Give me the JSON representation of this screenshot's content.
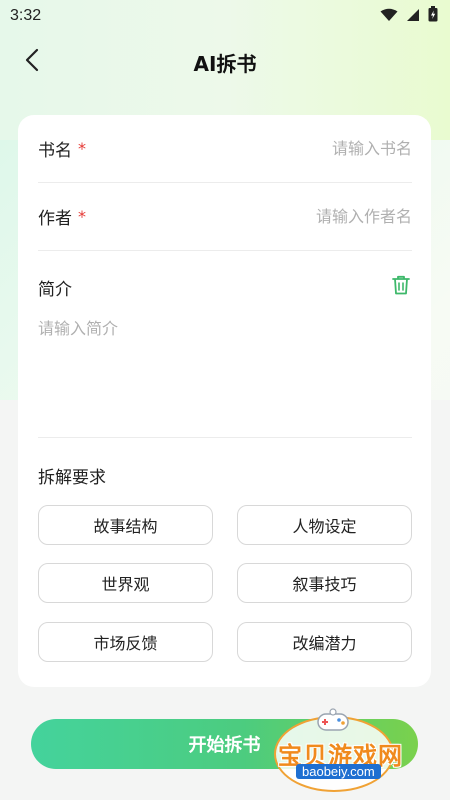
{
  "status_bar": {
    "time": "3:32"
  },
  "header": {
    "title": "AI拆书"
  },
  "form": {
    "book_name": {
      "label": "书名",
      "required_mark": "*",
      "placeholder": "请输入书名"
    },
    "author": {
      "label": "作者",
      "required_mark": "*",
      "placeholder": "请输入作者名"
    },
    "intro": {
      "label": "简介",
      "placeholder": "请输入简介"
    },
    "requirements": {
      "label": "拆解要求",
      "options": [
        "故事结构",
        "人物设定",
        "世界观",
        "叙事技巧",
        "市场反馈",
        "改编潜力"
      ]
    }
  },
  "start_button": {
    "label": "开始拆书"
  },
  "watermark": {
    "text": "宝贝游戏网",
    "url": "baobeiy.com"
  },
  "colors": {
    "accent_green": "#4ccc7f",
    "required_red": "#e53935",
    "trash_green": "#3db86a",
    "watermark_orange": "#f08a1c"
  }
}
